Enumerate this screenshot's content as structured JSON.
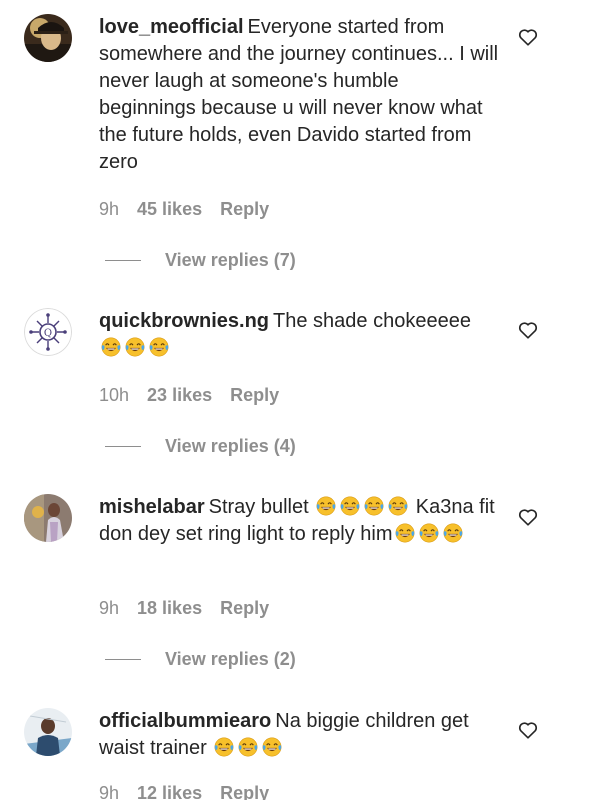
{
  "comments": [
    {
      "username": "love_meofficial",
      "text": "Everyone started from somewhere and the journey continues... I will never laugh at someone's humble beginnings because u will never know what the future holds, even Davido started from zero",
      "emoji_count": 0,
      "text_after": "",
      "emoji_count_after": 0,
      "time": "9h",
      "likes": "45 likes",
      "reply_label": "Reply",
      "view_replies": "View replies (7)"
    },
    {
      "username": "quickbrownies.ng",
      "text": "The shade chokeeeee",
      "emoji_count": 3,
      "text_after": "",
      "emoji_count_after": 0,
      "time": "10h",
      "likes": "23 likes",
      "reply_label": "Reply",
      "view_replies": "View replies (4)"
    },
    {
      "username": "mishelabar",
      "text": "Stray bullet",
      "emoji_count": 4,
      "text_after": "Ka3na fit don dey set ring light to reply him",
      "emoji_count_after": 3,
      "time": "9h",
      "likes": "18 likes",
      "reply_label": "Reply",
      "view_replies": "View replies (2)"
    },
    {
      "username": "officialbummiearo",
      "text": "Na biggie children get waist trainer",
      "emoji_count": 3,
      "text_after": "",
      "emoji_count_after": 0,
      "time": "9h",
      "likes": "12 likes",
      "reply_label": "Reply",
      "view_replies": ""
    }
  ],
  "icons": {
    "heart": "heart-outline-icon",
    "emoji": "face-with-tears-of-joy"
  },
  "colors": {
    "text": "#262626",
    "secondary": "#8e8e8e",
    "emoji_face": "#f7c02b"
  }
}
